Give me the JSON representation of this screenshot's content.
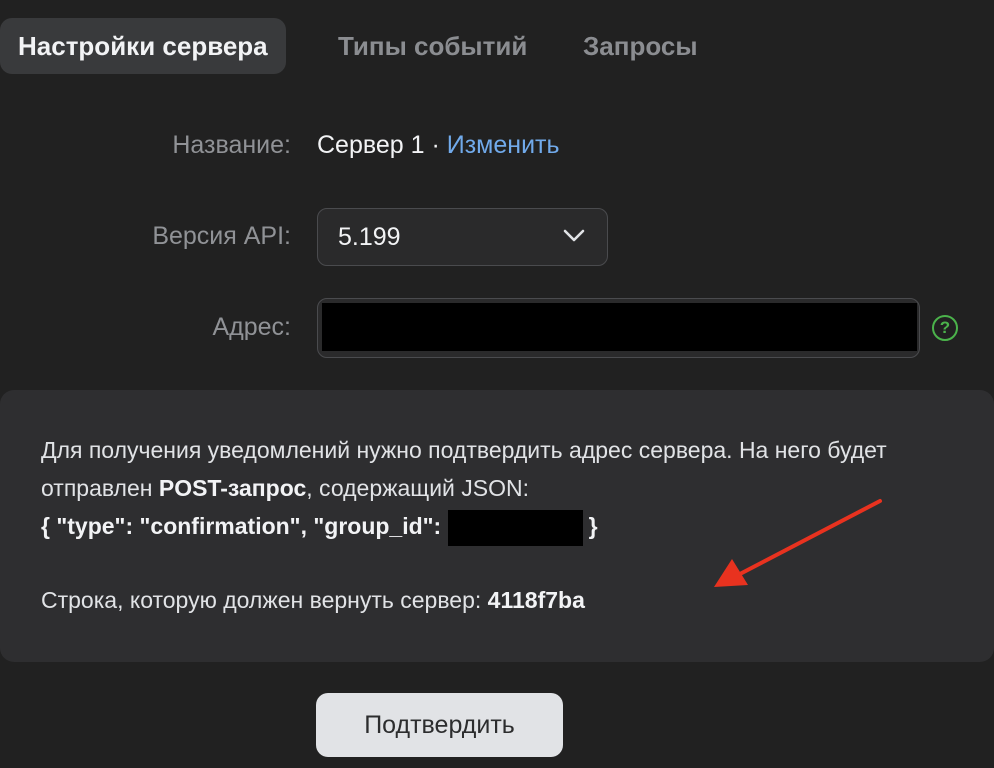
{
  "tabs": [
    {
      "label": "Настройки сервера",
      "active": true
    },
    {
      "label": "Типы событий",
      "active": false
    },
    {
      "label": "Запросы",
      "active": false
    }
  ],
  "form": {
    "name_label": "Название:",
    "name_value": "Сервер 1",
    "name_separator": " · ",
    "name_edit_link": "Изменить",
    "api_label": "Версия API:",
    "api_value": "5.199",
    "address_label": "Адрес:",
    "help_icon": "question-circle-icon",
    "help_glyph": "?"
  },
  "info": {
    "line1": "Для получения уведомлений нужно подтвердить адрес сервера. На него будет отправлен ",
    "post_bold": "POST-запрос",
    "line1_tail": ", содержащий JSON:",
    "json_prefix": "{ \"type\": \"confirmation\", \"group_id\": ",
    "json_suffix": "}",
    "answer_label": "Строка, которую должен вернуть сервер: ",
    "answer_code": "4118f7ba"
  },
  "confirm_button": "Подтвердить",
  "colors": {
    "background": "#212121",
    "panel": "#2e2e30",
    "link": "#71aaeb",
    "help": "#4bb34b",
    "annotation_arrow": "#e8321f",
    "button": "#e1e3e6"
  }
}
